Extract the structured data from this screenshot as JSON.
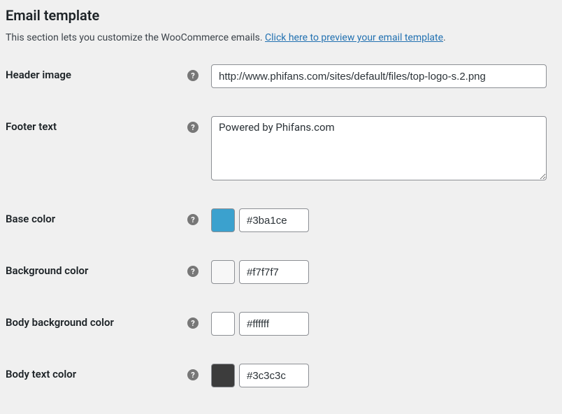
{
  "section": {
    "title": "Email template",
    "intro_text": "This section lets you customize the WooCommerce emails. ",
    "intro_link": "Click here to preview your email template",
    "intro_suffix": "."
  },
  "fields": {
    "header_image": {
      "label": "Header image",
      "value": "http://www.phifans.com/sites/default/files/top-logo-s.2.png"
    },
    "footer_text": {
      "label": "Footer text",
      "value": "Powered by Phifans.com"
    },
    "base_color": {
      "label": "Base color",
      "value": "#3ba1ce",
      "swatch": "#3ba1ce"
    },
    "background_color": {
      "label": "Background color",
      "value": "#f7f7f7",
      "swatch": "#f7f7f7"
    },
    "body_background_color": {
      "label": "Body background color",
      "value": "#ffffff",
      "swatch": "#ffffff"
    },
    "body_text_color": {
      "label": "Body text color",
      "value": "#3c3c3c",
      "swatch": "#3c3c3c"
    }
  }
}
